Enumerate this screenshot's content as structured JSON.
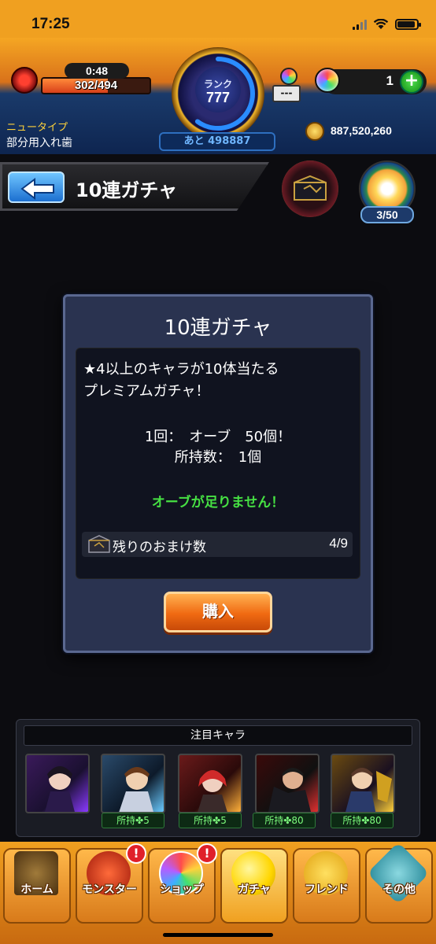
{
  "status": {
    "time": "17:25"
  },
  "header": {
    "stamina_timer": "0:48",
    "stamina": "302/494",
    "stamina_fraction": 0.611,
    "rank_label": "ランク",
    "rank_value": "777",
    "rank_progress": 0.6,
    "rank_next": "あと 498887",
    "treasure_value": "---",
    "orb_count": "1",
    "player_type": "ニュータイプ",
    "player_name": "部分用入れ歯",
    "coins": "887,520,260"
  },
  "title_bar": {
    "title": "10連ガチャ",
    "medal_count": "3/50"
  },
  "dialog": {
    "title": "10連ガチャ",
    "desc_line1": "★4以上のキャラが10体当たる",
    "desc_line2": "プレミアムガチャ！",
    "cost": "1回：　オーブ　50個！",
    "owned": "所持数：　1個",
    "warning": "オーブが足りません！",
    "bonus_label": "残りのおまけ数",
    "bonus_value": "4/9",
    "buy_label": "購入"
  },
  "featured": {
    "title": "注目キャラ",
    "chars": [
      {
        "name": "char-1",
        "owned": ""
      },
      {
        "name": "char-2",
        "owned": "所持✤5"
      },
      {
        "name": "char-3",
        "owned": "所持✤5"
      },
      {
        "name": "char-4",
        "owned": "所持✤80"
      },
      {
        "name": "char-5",
        "owned": "所持✤80"
      }
    ]
  },
  "nav": [
    {
      "label": "ホーム",
      "icon": "home-icon",
      "badge": ""
    },
    {
      "label": "モンスター",
      "icon": "monster-icon",
      "badge": "!"
    },
    {
      "label": "ショップ",
      "icon": "shop-orb-icon",
      "badge": "!"
    },
    {
      "label": "ガチャ",
      "icon": "gacha-icon",
      "badge": ""
    },
    {
      "label": "フレンド",
      "icon": "friend-icon",
      "badge": ""
    },
    {
      "label": "その他",
      "icon": "other-icon",
      "badge": ""
    }
  ],
  "colors": {
    "accent": "#f0a020",
    "warning": "#46e043",
    "buy": "#f06a12"
  }
}
